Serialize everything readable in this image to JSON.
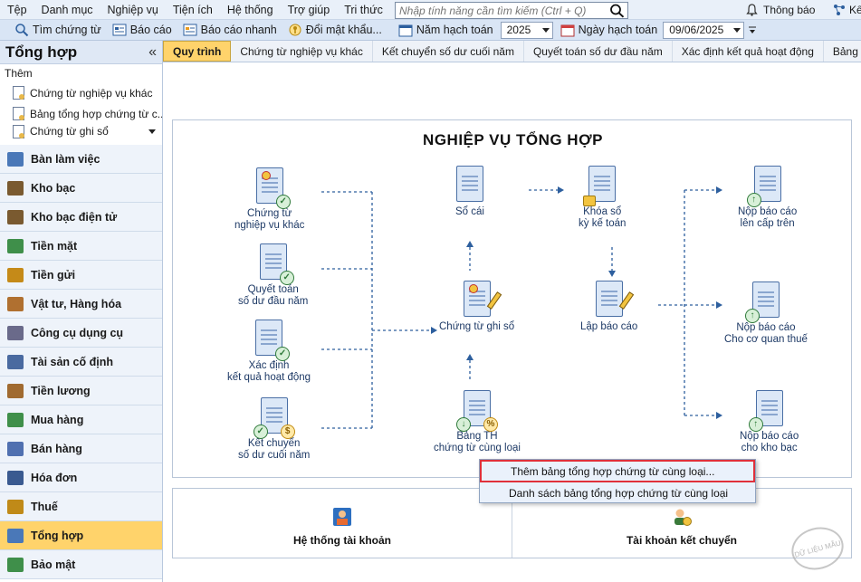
{
  "menubar": {
    "items": [
      "Tệp",
      "Danh mục",
      "Nghiệp vụ",
      "Tiện ích",
      "Hệ thống",
      "Trợ giúp",
      "Tri thức"
    ],
    "search_placeholder": "Nhập tính năng cần tìm kiếm (Ctrl + Q)",
    "notify_label": "Thông báo",
    "right_label": "Kế"
  },
  "toolbar": {
    "find_voucher": "Tìm chứng từ",
    "report": "Báo cáo",
    "quick_report": "Báo cáo nhanh",
    "change_password": "Đổi mật khẩu...",
    "fiscal_year_label": "Năm hạch toán",
    "fiscal_year_value": "2025",
    "posting_date_label": "Ngày hạch toán",
    "posting_date_value": "09/06/2025"
  },
  "sidebar": {
    "title": "Tổng hợp",
    "collapse": "«",
    "add_label": "Thêm",
    "sub_items": [
      "Chứng từ nghiệp vụ khác",
      "Bảng tổng hợp chứng từ c...",
      "Chứng từ ghi sổ"
    ],
    "nav": [
      {
        "label": "Bàn làm việc",
        "icon": "desk-icon",
        "color": "#4a78b8"
      },
      {
        "label": "Kho bạc",
        "icon": "treasury-icon",
        "color": "#7a5a30"
      },
      {
        "label": "Kho bạc điện tử",
        "icon": "e-treasury-icon",
        "color": "#7a5a30"
      },
      {
        "label": "Tiền mặt",
        "icon": "cash-icon",
        "color": "#3f8f4a"
      },
      {
        "label": "Tiền gửi",
        "icon": "deposit-icon",
        "color": "#c58a18"
      },
      {
        "label": "Vật tư, Hàng hóa",
        "icon": "goods-icon",
        "color": "#b07030"
      },
      {
        "label": "Công cụ dụng cụ",
        "icon": "tools-icon",
        "color": "#6a6a8a"
      },
      {
        "label": "Tài sản cố định",
        "icon": "fixed-asset-icon",
        "color": "#4a6aa0"
      },
      {
        "label": "Tiền lương",
        "icon": "salary-icon",
        "color": "#a06a30"
      },
      {
        "label": "Mua hàng",
        "icon": "purchase-icon",
        "color": "#3f8f4a"
      },
      {
        "label": "Bán hàng",
        "icon": "sales-icon",
        "color": "#5070b0"
      },
      {
        "label": "Hóa đơn",
        "icon": "invoice-icon",
        "color": "#3a5a90"
      },
      {
        "label": "Thuế",
        "icon": "tax-icon",
        "color": "#c08a18"
      },
      {
        "label": "Tổng hợp",
        "icon": "summary-icon",
        "color": "#4a78b8",
        "active": true
      },
      {
        "label": "Bảo mật",
        "icon": "security-icon",
        "color": "#3f8f4a"
      }
    ]
  },
  "tabs": [
    "Quy trình",
    "Chứng từ nghiệp vụ khác",
    "Kết chuyển số dư cuối năm",
    "Quyết toán số dư đầu năm",
    "Xác định kết quả hoạt động",
    "Bảng tổng hợp chứ"
  ],
  "flow": {
    "title": "NGHIỆP VỤ TỔNG HỢP",
    "nodes": {
      "other_voucher": [
        "Chứng từ",
        "nghiệp vụ khác"
      ],
      "opening_settlement": [
        "Quyết toán",
        "số dư đầu năm"
      ],
      "result_determination": [
        "Xác định",
        "kết quả hoạt động"
      ],
      "closing_transfer": [
        "Kết chuyển",
        "số dư cuối năm"
      ],
      "ledger": [
        "Sổ cái"
      ],
      "voucher_record": [
        "Chứng từ ghi sổ"
      ],
      "summary_voucher": [
        "Bảng TH",
        "chứng từ cùng loại"
      ],
      "lock_book": [
        "Khóa sổ",
        "kỳ kế toán"
      ],
      "create_report": [
        "Lập báo cáo"
      ],
      "submit_superior": [
        "Nộp báo cáo",
        "lên cấp trên"
      ],
      "submit_tax": [
        "Nộp báo cáo",
        "Cho cơ quan thuế"
      ],
      "submit_treasury": [
        "Nộp báo cáo",
        "cho kho bạc"
      ]
    }
  },
  "bottom": {
    "accounts": "Hệ thống tài khoản",
    "transfer_accounts": "Tài khoản kết chuyển"
  },
  "popup": {
    "add": "Thêm bảng tổng hợp chứng từ cùng loại...",
    "list": "Danh sách bảng tổng hợp chứng từ cùng loại"
  },
  "watermark": "DỮ LIỆU MẪU"
}
